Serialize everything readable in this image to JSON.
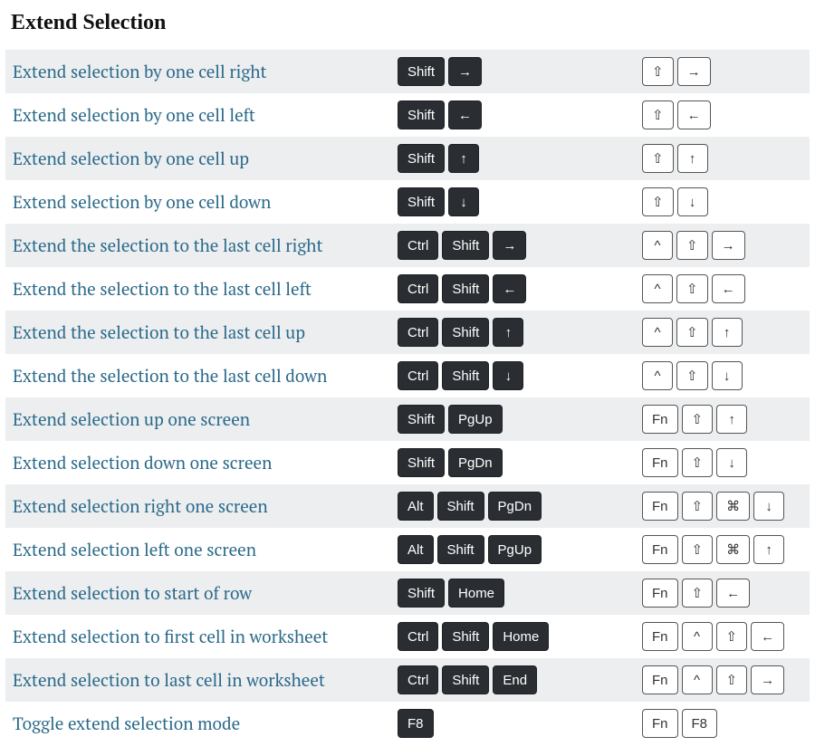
{
  "title": "Extend Selection",
  "rows": [
    {
      "desc": "Extend selection by one cell right",
      "win": [
        "Shift",
        "→"
      ],
      "mac": [
        "⇧",
        "→"
      ]
    },
    {
      "desc": "Extend selection by one cell left",
      "win": [
        "Shift",
        "←"
      ],
      "mac": [
        "⇧",
        "←"
      ]
    },
    {
      "desc": "Extend selection by one cell up",
      "win": [
        "Shift",
        "↑"
      ],
      "mac": [
        "⇧",
        "↑"
      ]
    },
    {
      "desc": "Extend selection by one cell down",
      "win": [
        "Shift",
        "↓"
      ],
      "mac": [
        "⇧",
        "↓"
      ]
    },
    {
      "desc": "Extend the selection to the last cell right",
      "win": [
        "Ctrl",
        "Shift",
        "→"
      ],
      "mac": [
        "^",
        "⇧",
        "→"
      ]
    },
    {
      "desc": "Extend the selection to the last cell left",
      "win": [
        "Ctrl",
        "Shift",
        "←"
      ],
      "mac": [
        "^",
        "⇧",
        "←"
      ]
    },
    {
      "desc": "Extend the selection to the last cell up",
      "win": [
        "Ctrl",
        "Shift",
        "↑"
      ],
      "mac": [
        "^",
        "⇧",
        "↑"
      ]
    },
    {
      "desc": "Extend the selection to the last cell down",
      "win": [
        "Ctrl",
        "Shift",
        "↓"
      ],
      "mac": [
        "^",
        "⇧",
        "↓"
      ]
    },
    {
      "desc": "Extend selection up one screen",
      "win": [
        "Shift",
        "PgUp"
      ],
      "mac": [
        "Fn",
        "⇧",
        "↑"
      ]
    },
    {
      "desc": "Extend selection down one screen",
      "win": [
        "Shift",
        "PgDn"
      ],
      "mac": [
        "Fn",
        "⇧",
        "↓"
      ]
    },
    {
      "desc": "Extend selection right one screen",
      "win": [
        "Alt",
        "Shift",
        "PgDn"
      ],
      "mac": [
        "Fn",
        "⇧",
        "⌘",
        "↓"
      ]
    },
    {
      "desc": "Extend selection left one screen",
      "win": [
        "Alt",
        "Shift",
        "PgUp"
      ],
      "mac": [
        "Fn",
        "⇧",
        "⌘",
        "↑"
      ]
    },
    {
      "desc": "Extend selection to start of row",
      "win": [
        "Shift",
        "Home"
      ],
      "mac": [
        "Fn",
        "⇧",
        "←"
      ]
    },
    {
      "desc": "Extend selection to first cell in worksheet",
      "win": [
        "Ctrl",
        "Shift",
        "Home"
      ],
      "mac": [
        "Fn",
        "^",
        "⇧",
        "←"
      ]
    },
    {
      "desc": "Extend selection to last cell in worksheet",
      "win": [
        "Ctrl",
        "Shift",
        "End"
      ],
      "mac": [
        "Fn",
        "^",
        "⇧",
        "→"
      ]
    },
    {
      "desc": "Toggle extend selection mode",
      "win": [
        "F8"
      ],
      "mac": [
        "Fn",
        "F8"
      ]
    }
  ]
}
